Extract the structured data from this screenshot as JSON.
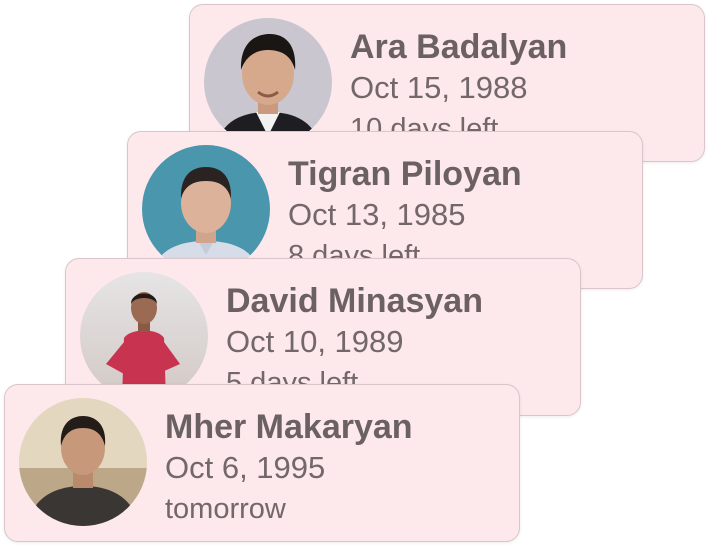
{
  "cards": [
    {
      "name": "Ara Badalyan",
      "date": "Oct 15, 1988",
      "days_left": "10 days left",
      "avatar_icon": "person-avatar-icon"
    },
    {
      "name": "Tigran Piloyan",
      "date": "Oct 13, 1985",
      "days_left": "8 days left",
      "avatar_icon": "person-avatar-icon"
    },
    {
      "name": "David Minasyan",
      "date": "Oct 10, 1989",
      "days_left": "5 days left",
      "avatar_icon": "person-avatar-icon"
    },
    {
      "name": "Mher Makaryan",
      "date": "Oct 6, 1995",
      "days_left": "tomorrow",
      "avatar_icon": "person-avatar-icon"
    }
  ],
  "colors": {
    "card_background": "#fde8ec",
    "card_border": "#d9c5ca",
    "text": "#6b6163"
  }
}
